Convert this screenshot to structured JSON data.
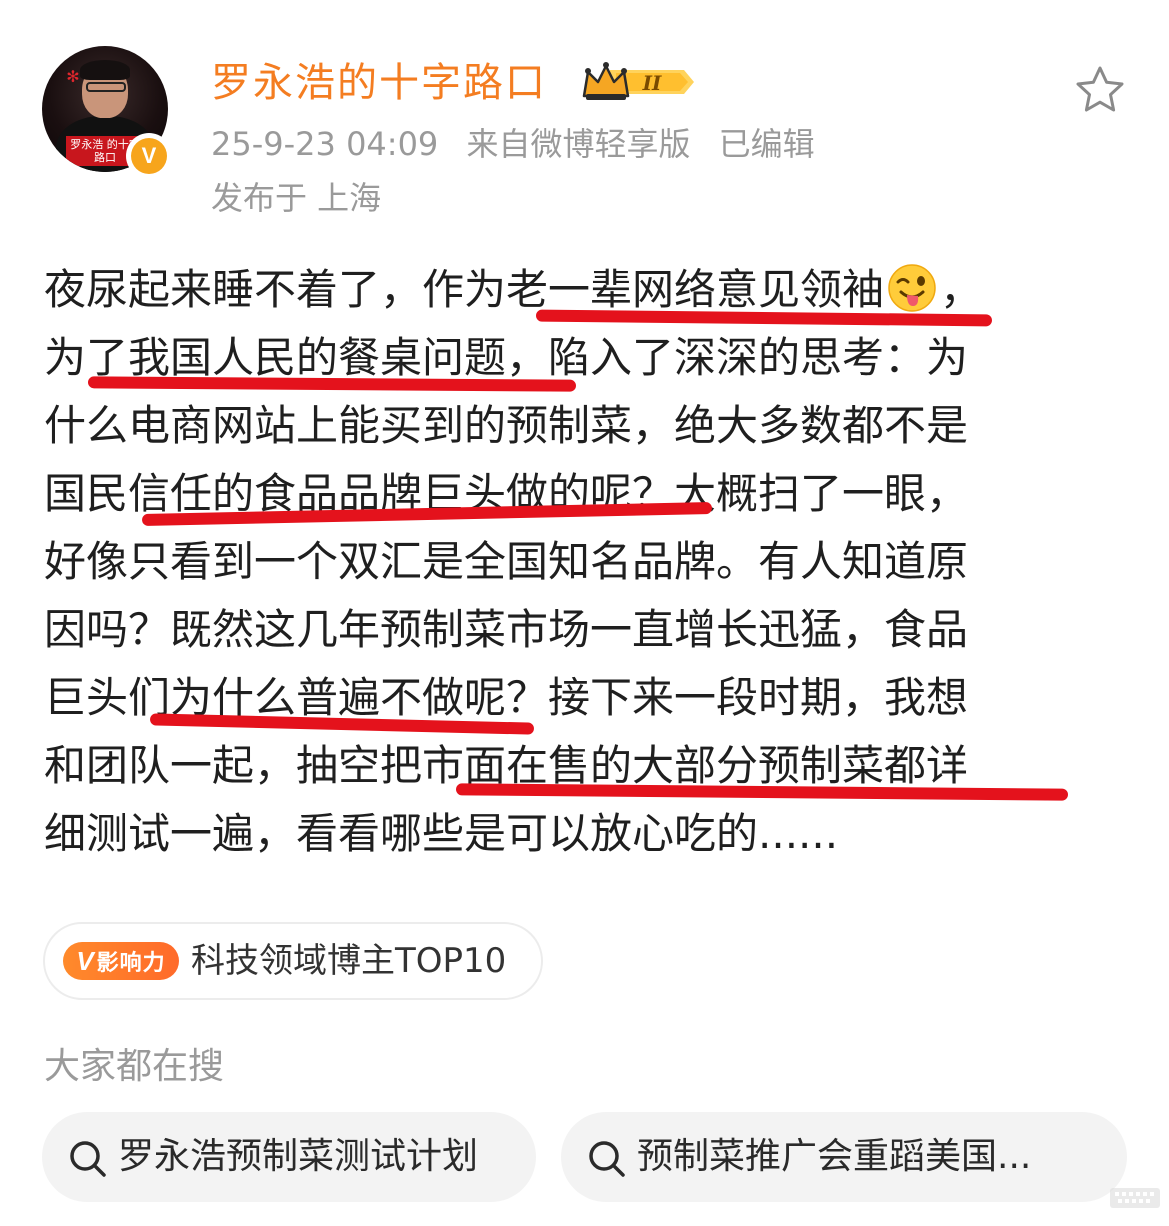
{
  "header": {
    "username": "罗永浩的十字路口",
    "rank_badge": "II",
    "timestamp": "25-9-23 04:09",
    "source": "来自微博轻享版",
    "edited": "已编辑",
    "location": "发布于 上海",
    "avatar_caption": "罗永浩 的十字路口",
    "verified_mark": "V"
  },
  "post": {
    "lines": [
      "夜尿起来睡不着了，作为老一辈网络意见领袖",
      "为了我国人民的餐桌问题，陷入了深深的思考：为",
      "什么电商网站上能买到的预制菜，绝大多数都不是",
      "国民信任的食品品牌巨头做的呢？大概扫了一眼，",
      "好像只看到一个双汇是全国知名品牌。有人知道原",
      "因吗？既然这几年预制菜市场一直增长迅猛，食品",
      "巨头们为什么普遍不做呢？接下来一段时期，我想",
      "和团队一起，抽空把市面在售的大部分预制菜都详",
      "细测试一遍，看看哪些是可以放心吃的......"
    ],
    "line1_tail": "，",
    "emoji": "wink-tongue-emoji"
  },
  "influence": {
    "badge_v": "V",
    "badge_text": "影响力",
    "label": "科技领域博主TOP10"
  },
  "trending": {
    "heading": "大家都在搜",
    "items": [
      "罗永浩预制菜测试计划",
      "预制菜推广会重蹈美国..."
    ]
  },
  "colors": {
    "username": "#f47d21",
    "underline": "#e4121c",
    "meta": "#9a9a9a"
  },
  "icons": [
    "star-icon",
    "search-icon",
    "crown-icon",
    "verified-icon"
  ]
}
